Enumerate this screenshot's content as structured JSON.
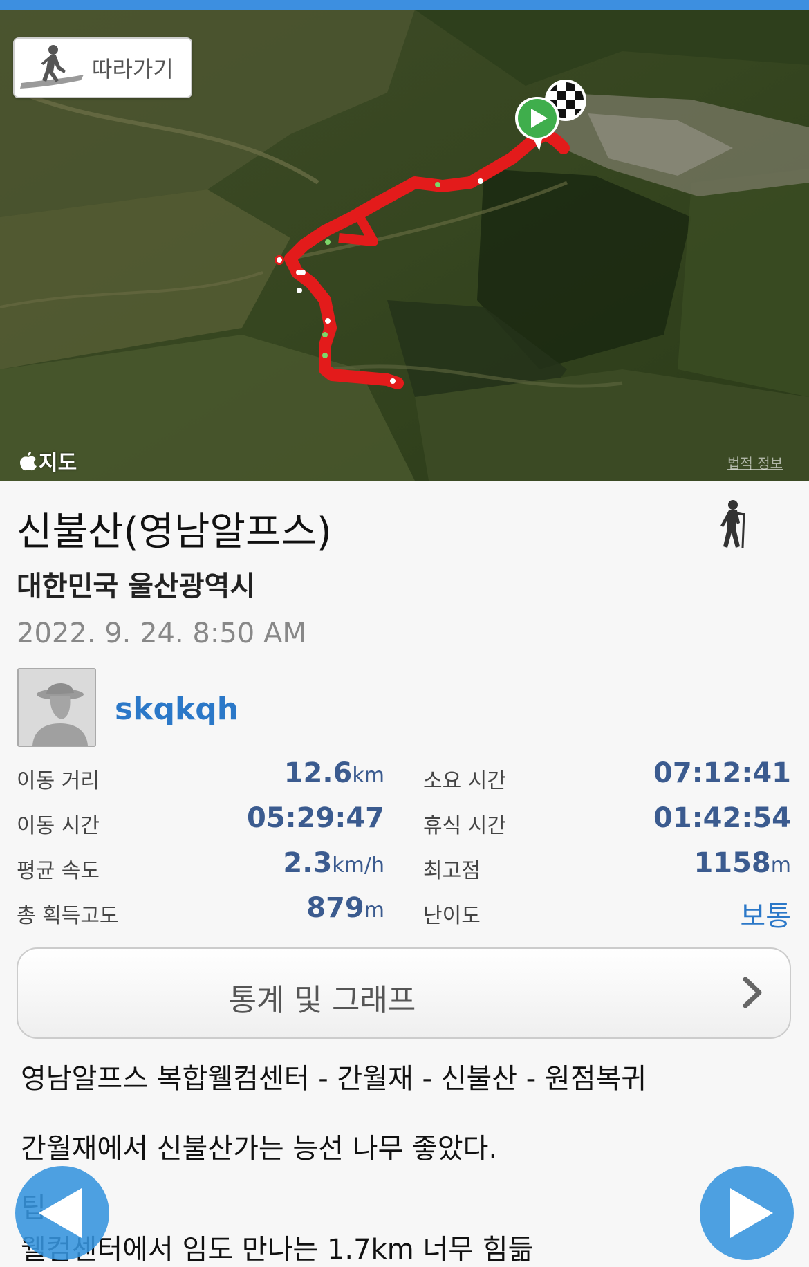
{
  "map": {
    "follow_label": "따라가기",
    "attribution": "지도",
    "legal": "법적 정보"
  },
  "trip": {
    "title": "신불산(영남알프스)",
    "region": "대한민국 울산광역시",
    "date": "2022. 9. 24. 8:50 AM",
    "username": "skqkqh"
  },
  "stats": [
    {
      "label": "이동 거리",
      "value": "12.6",
      "unit": "km"
    },
    {
      "label": "소요 시간",
      "value": "07:12:41",
      "unit": ""
    },
    {
      "label": "이동 시간",
      "value": "05:29:47",
      "unit": ""
    },
    {
      "label": "휴식 시간",
      "value": "01:42:54",
      "unit": ""
    },
    {
      "label": "평균 속도",
      "value": "2.3",
      "unit": "km/h"
    },
    {
      "label": "최고점",
      "value": "1158",
      "unit": "m"
    },
    {
      "label": "총 획득고도",
      "value": "879",
      "unit": "m"
    },
    {
      "label": "난이도",
      "value": "보통",
      "unit": ""
    }
  ],
  "stats_button": "통계 및 그래프",
  "description": [
    "영남알프스 복합웰컴센터 - 간월재 - 신불산 - 원점복귀",
    "간월재에서 신불산가는 능선 나무 좋았다.",
    "팁",
    "웰컴센터에서 임도 만나는 1.7km 너무 힘듦"
  ],
  "colors": {
    "accent": "#3d8fe0",
    "link": "#2b78c8",
    "stat_value": "#3b5b8f",
    "track": "#e31b1b",
    "nav_button": "#3694de"
  },
  "icons": {
    "follow": "walker-icon",
    "activity": "hiker-icon",
    "start": "play-marker-icon",
    "finish": "checkered-flag-icon",
    "prev": "left-arrow-icon",
    "next": "right-arrow-icon"
  }
}
